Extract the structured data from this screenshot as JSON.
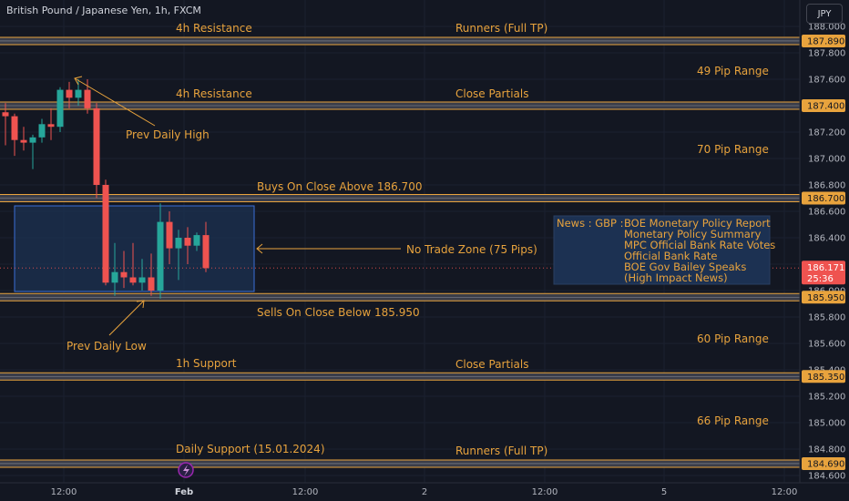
{
  "header": {
    "title": "British Pound / Japanese Yen, 1h, FXCM",
    "currency_button": "JPY"
  },
  "colors": {
    "background": "#131722",
    "up": "#26a69a",
    "down": "#ef5350",
    "level": "#e8a33d",
    "zone_fill": "#1c3152",
    "zone_border": "#2962ff",
    "axis_text": "#b2b5be"
  },
  "chart_data": {
    "type": "candlestick",
    "ylim": [
      184.6,
      188.0
    ],
    "y_ticks": [
      "188.000",
      "187.800",
      "187.600",
      "187.400",
      "187.200",
      "187.000",
      "186.800",
      "186.600",
      "186.400",
      "186.200",
      "186.000",
      "185.800",
      "185.600",
      "185.400",
      "185.200",
      "185.000",
      "184.800",
      "184.600"
    ],
    "x_ticks": [
      "12:00",
      "Feb",
      "12:00",
      "2",
      "12:00",
      "5",
      "12:00"
    ],
    "candles": [
      {
        "o": 187.35,
        "h": 187.42,
        "l": 187.1,
        "c": 187.32
      },
      {
        "o": 187.32,
        "h": 187.34,
        "l": 187.02,
        "c": 187.14
      },
      {
        "o": 187.14,
        "h": 187.24,
        "l": 187.06,
        "c": 187.12
      },
      {
        "o": 187.12,
        "h": 187.18,
        "l": 186.92,
        "c": 187.16
      },
      {
        "o": 187.16,
        "h": 187.3,
        "l": 187.12,
        "c": 187.26
      },
      {
        "o": 187.26,
        "h": 187.38,
        "l": 187.14,
        "c": 187.24
      },
      {
        "o": 187.24,
        "h": 187.54,
        "l": 187.2,
        "c": 187.52
      },
      {
        "o": 187.52,
        "h": 187.58,
        "l": 187.38,
        "c": 187.46
      },
      {
        "o": 187.46,
        "h": 187.6,
        "l": 187.4,
        "c": 187.52
      },
      {
        "o": 187.52,
        "h": 187.6,
        "l": 187.34,
        "c": 187.38
      },
      {
        "o": 187.38,
        "h": 187.42,
        "l": 186.7,
        "c": 186.8
      },
      {
        "o": 186.8,
        "h": 186.84,
        "l": 186.04,
        "c": 186.06
      },
      {
        "o": 186.06,
        "h": 186.36,
        "l": 185.96,
        "c": 186.14
      },
      {
        "o": 186.14,
        "h": 186.3,
        "l": 186.02,
        "c": 186.1
      },
      {
        "o": 186.1,
        "h": 186.36,
        "l": 186.04,
        "c": 186.06
      },
      {
        "o": 186.06,
        "h": 186.24,
        "l": 186.0,
        "c": 186.1
      },
      {
        "o": 186.1,
        "h": 186.28,
        "l": 185.96,
        "c": 186.0
      },
      {
        "o": 186.0,
        "h": 186.66,
        "l": 185.94,
        "c": 186.52
      },
      {
        "o": 186.52,
        "h": 186.6,
        "l": 186.2,
        "c": 186.32
      },
      {
        "o": 186.32,
        "h": 186.46,
        "l": 186.08,
        "c": 186.4
      },
      {
        "o": 186.4,
        "h": 186.48,
        "l": 186.2,
        "c": 186.34
      },
      {
        "o": 186.34,
        "h": 186.44,
        "l": 186.3,
        "c": 186.42
      },
      {
        "o": 186.42,
        "h": 186.52,
        "l": 186.14,
        "c": 186.17
      }
    ],
    "levels": [
      {
        "price": 187.89,
        "label": "187.890"
      },
      {
        "price": 187.4,
        "label": "187.400"
      },
      {
        "price": 186.7,
        "label": "186.700"
      },
      {
        "price": 185.95,
        "label": "185.950"
      },
      {
        "price": 185.35,
        "label": "185.350"
      },
      {
        "price": 184.69,
        "label": "184.690"
      }
    ],
    "current_price": {
      "price": 186.171,
      "label": "186.171",
      "countdown": "25:36"
    },
    "annotations": {
      "res1": "4h Resistance",
      "runners_top": "Runners (Full TP)",
      "range49": "49 Pip Range",
      "res2": "4h Resistance",
      "partials_top": "Close Partials",
      "prev_high": "Prev Daily High",
      "range70": "70 Pip Range",
      "buys": "Buys On Close Above 186.700",
      "no_trade": "No Trade Zone (75 Pips)",
      "sells": "Sells On Close Below 185.950",
      "prev_low": "Prev Daily Low",
      "range60": "60 Pip Range",
      "support1h": "1h Support",
      "partials_bottom": "Close Partials",
      "range66": "66 Pip Range",
      "daily_support": "Daily Support (15.01.2024)",
      "runners_bottom": "Runners (Full TP)"
    },
    "news": {
      "prefix": "News : GBP :",
      "items": [
        "BOE Monetary Policy Report",
        "Monetary Policy Summary",
        "MPC Official Bank Rate Votes",
        "Official Bank Rate",
        "BOE Gov Bailey Speaks",
        "(High Impact News)"
      ]
    }
  }
}
